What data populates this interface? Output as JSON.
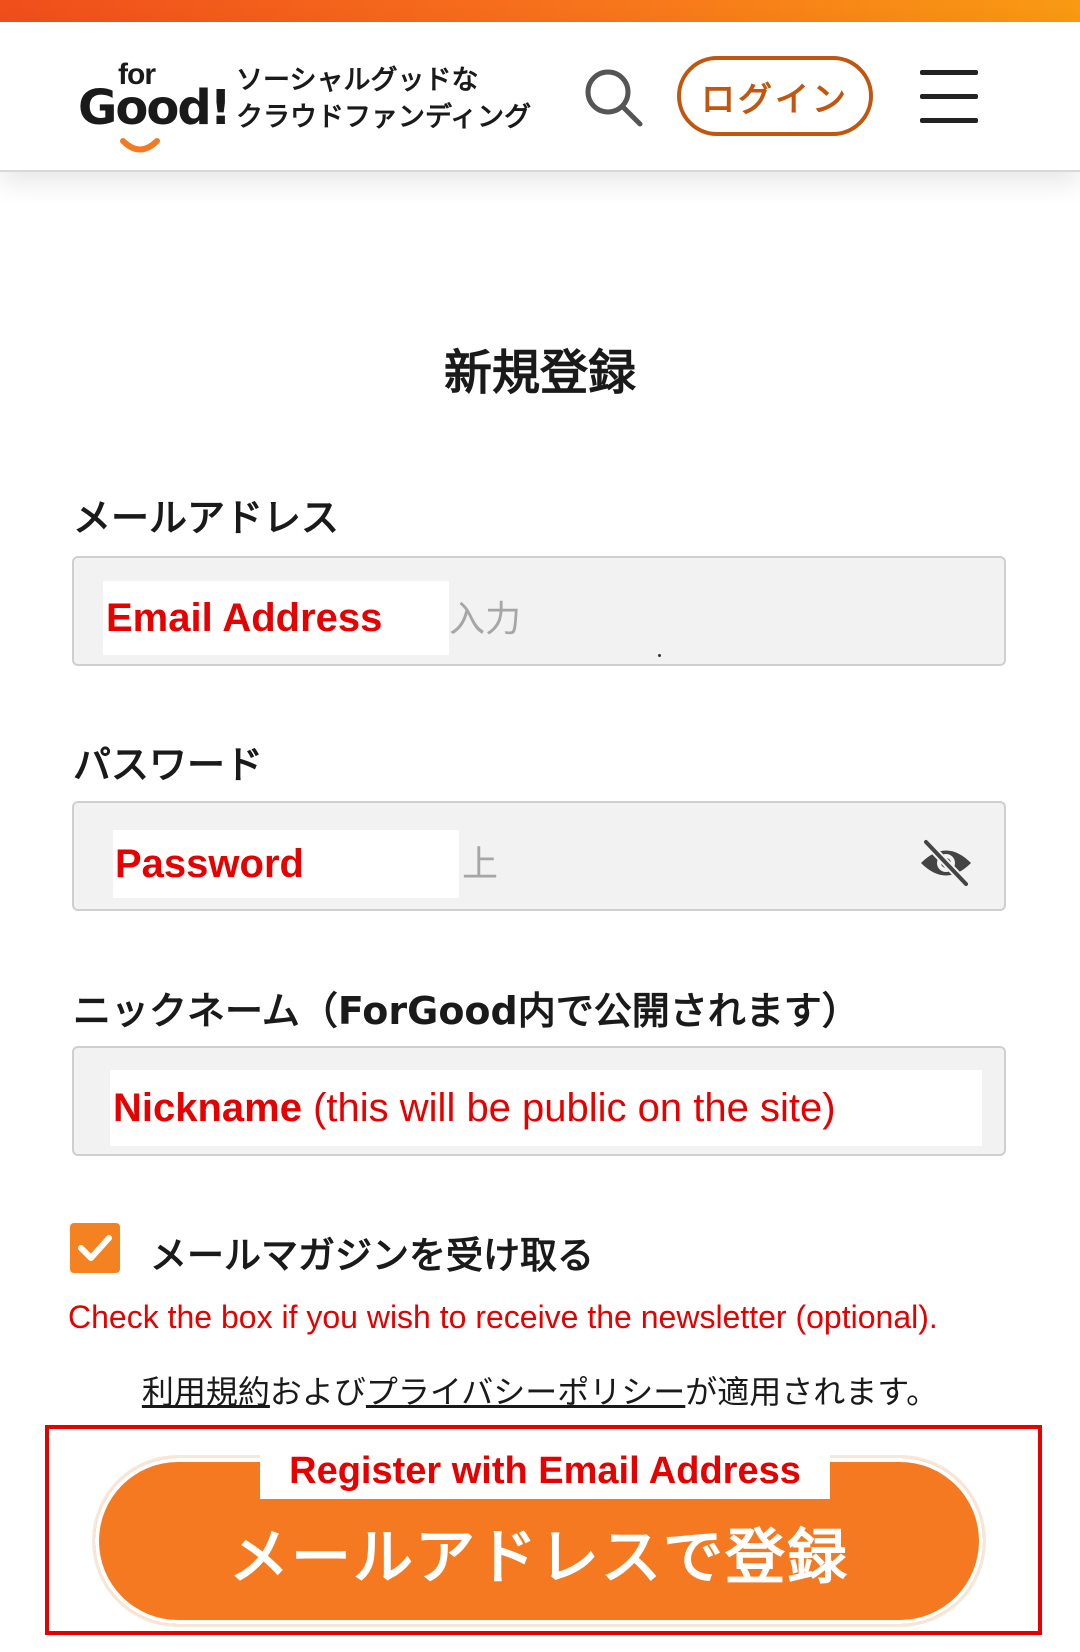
{
  "header": {
    "logo_for": "for",
    "logo_good": "Good!",
    "tagline_line1": "ソーシャルグッドな",
    "tagline_line2": "クラウドファンディング",
    "login_label": "ログイン",
    "search_icon": "search-icon",
    "menu_icon": "hamburger-menu-icon"
  },
  "page_title": "新規登録",
  "fields": {
    "email_label": "メールアドレス",
    "email_placeholder_tail": "入力",
    "email_overlay": "Email Address",
    "password_label": "パスワード",
    "password_placeholder_tail": "上",
    "password_overlay": "Password",
    "password_toggle_icon": "eye-slash-icon",
    "nickname_label": "ニックネーム（ForGood内で公開されます）",
    "nickname_overlay_bold": "Nickname",
    "nickname_overlay_rest": " (this will be public on the site)"
  },
  "newsletter": {
    "checked": true,
    "label": "メールマガジンを受け取る",
    "note": "Check the box if you wish to receive the newsletter (optional)."
  },
  "terms": {
    "terms_link": "利用規約",
    "and": "および",
    "privacy_link": "プライバシーポリシー",
    "suffix": "が適用されます。"
  },
  "register": {
    "button_label": "メールアドレスで登録",
    "overlay": "Register with Email Address"
  },
  "colors": {
    "brand_orange": "#f47920",
    "login_border": "#c2560f",
    "annotation_red": "#e60000"
  }
}
